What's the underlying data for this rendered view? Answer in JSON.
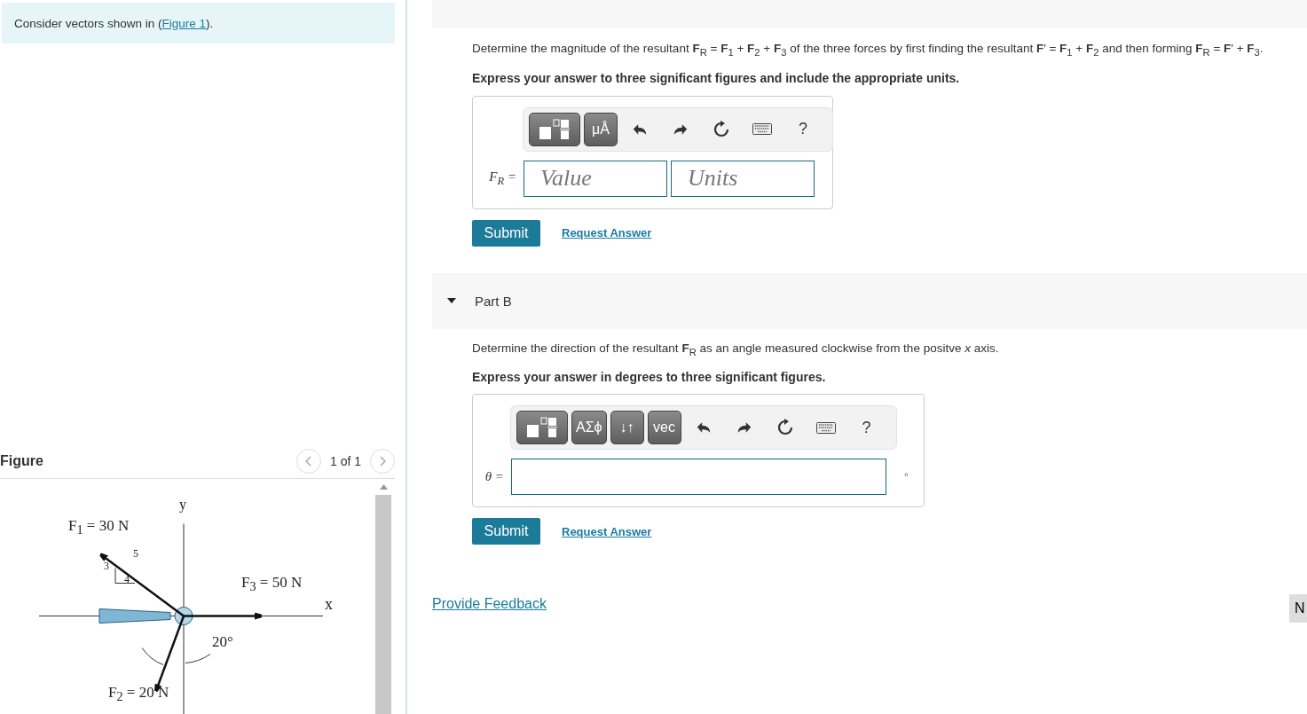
{
  "intro": {
    "before": "Consider vectors shown in (",
    "link": "Figure 1",
    "after": ")."
  },
  "figure_panel": {
    "title": "Figure",
    "pager": "1 of 1",
    "labels": [
      {
        "text": "y"
      },
      {
        "text": "F$_{1}$ = 30 N"
      },
      {
        "text": "5"
      },
      {
        "text": "3"
      },
      {
        "text": "4"
      },
      {
        "text": "F$_{3}$ = 50 N"
      },
      {
        "text": "x"
      },
      {
        "text": "20°"
      },
      {
        "text": "F$_{2}$ = 20 N"
      }
    ]
  },
  "part_a": {
    "question": "Determine the magnitude of the resultant **F**$_{R}$ = **F**$_{1}$ + **F**$_{2}$ + **F**$_{3}$ of the three forces by first finding the resultant **F**′ = **F**$_{1}$ + **F**$_{2}$ and then forming **F**$_{R}$ = **F**′ + **F**$_{3}$.",
    "instruction": "Express your answer to three significant figures and include the appropriate units.",
    "toolbar": [
      {
        "kind": "template"
      },
      {
        "kind": "symbol",
        "text": "μÅ"
      },
      {
        "kind": "undo"
      },
      {
        "kind": "redo"
      },
      {
        "kind": "reset"
      },
      {
        "kind": "keyboard"
      },
      {
        "kind": "help",
        "text": "?"
      }
    ],
    "answer_label": "F$_{R}$ =",
    "fields": [
      {
        "placeholder": "Value"
      },
      {
        "placeholder": "Units"
      }
    ],
    "submit": "Submit",
    "request": "Request Answer"
  },
  "part_b": {
    "title": "Part B",
    "expanded": true,
    "question": "Determine the direction of the resultant **F**$_{R}$ as an angle measured clockwise from the positve *x* axis.",
    "instruction": "Express your answer in degrees to three significant figures.",
    "toolbar": [
      {
        "kind": "template"
      },
      {
        "kind": "symbol",
        "text": "ΑΣϕ"
      },
      {
        "kind": "symbol",
        "text": "↓↑"
      },
      {
        "kind": "symbol",
        "text": "vec"
      },
      {
        "kind": "undo"
      },
      {
        "kind": "redo"
      },
      {
        "kind": "reset"
      },
      {
        "kind": "keyboard"
      },
      {
        "kind": "help",
        "text": "?"
      }
    ],
    "answer_label": "θ =",
    "unit": "°",
    "submit": "Submit",
    "request": "Request Answer"
  },
  "feedback_link": "Provide Feedback",
  "next_button": "N"
}
